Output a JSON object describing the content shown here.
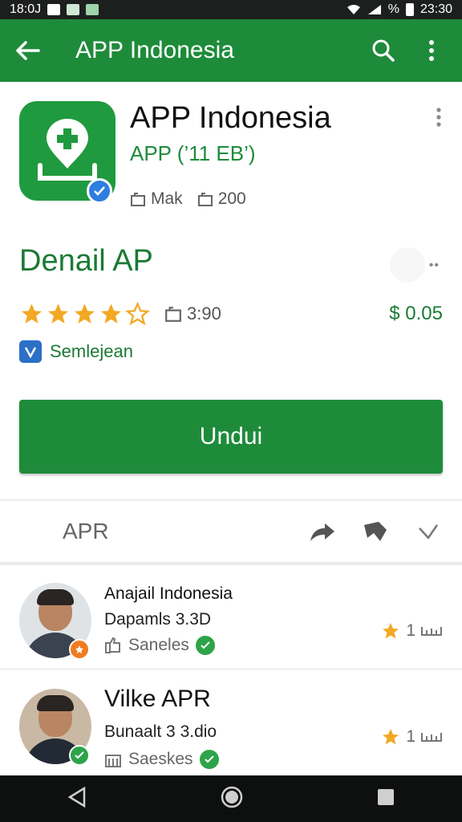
{
  "status_bar": {
    "time_left": "18:0J",
    "time_right": "23:30",
    "battery": "%"
  },
  "app_bar": {
    "title": "APP Indonesia"
  },
  "app": {
    "title": "APP Indonesia",
    "subtitle": "APP (’11 EB’)",
    "meta_1": "Mak",
    "meta_2": "200",
    "heading": "Denail AP",
    "more_dots": "••",
    "rating": 4.5,
    "rating_count": "3:90",
    "price": "$ 0.05",
    "developer": "Semlejean",
    "install_label": "Undui"
  },
  "section": {
    "label": "APR"
  },
  "reviews": [
    {
      "name": "Anajail Indonesia",
      "date": "Dapamls 3.3D",
      "foot": "Saneles",
      "score": "1",
      "badge_color": "#f07c1f"
    },
    {
      "name": "Vilke APR",
      "date": "Bunaalt 3 3.dio",
      "foot": "Saeskes",
      "score": "1",
      "badge_color": "#2ea34a"
    }
  ],
  "colors": {
    "primary": "#1e8b3a",
    "star": "#f2a823",
    "verified": "#2f7de1"
  }
}
